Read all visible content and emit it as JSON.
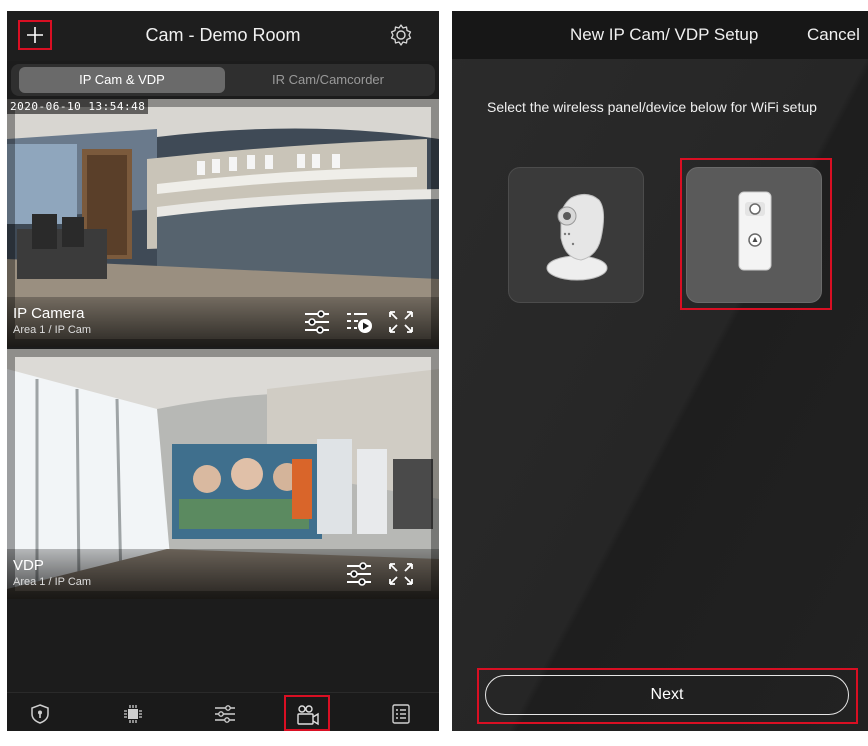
{
  "left_screen": {
    "header": {
      "title": "Cam - Demo Room",
      "add_icon": "plus-icon",
      "settings_icon": "gear-icon"
    },
    "segmented_tabs": [
      {
        "label": "IP Cam & VDP",
        "selected": true
      },
      {
        "label": "IR Cam/Camcorder",
        "selected": false
      }
    ],
    "feeds": [
      {
        "timestamp": "2020-06-10 13:54:48",
        "name": "IP Camera",
        "subtitle": "Area 1 / IP Cam",
        "controls": [
          "sliders-icon",
          "playback-icon",
          "fullscreen-icon"
        ]
      },
      {
        "name": "VDP",
        "subtitle": "Area 1 / IP Cam",
        "controls": [
          "sliders-icon",
          "fullscreen-icon"
        ]
      }
    ],
    "bottom_nav": [
      {
        "icon": "shield-icon",
        "selected": false
      },
      {
        "icon": "chip-icon",
        "selected": false
      },
      {
        "icon": "sliders-icon",
        "selected": false
      },
      {
        "icon": "video-camera-icon",
        "selected": true
      },
      {
        "icon": "list-icon",
        "selected": false
      }
    ],
    "highlight_color": "#d90f23"
  },
  "right_screen": {
    "header": {
      "title": "New IP Cam/ VDP Setup",
      "cancel_label": "Cancel"
    },
    "instruction": "Select the wireless panel/device below for WiFi setup",
    "devices": [
      {
        "icon": "ip-camera-icon",
        "selected": false
      },
      {
        "icon": "video-door-phone-icon",
        "selected": true
      }
    ],
    "next_label": "Next"
  }
}
